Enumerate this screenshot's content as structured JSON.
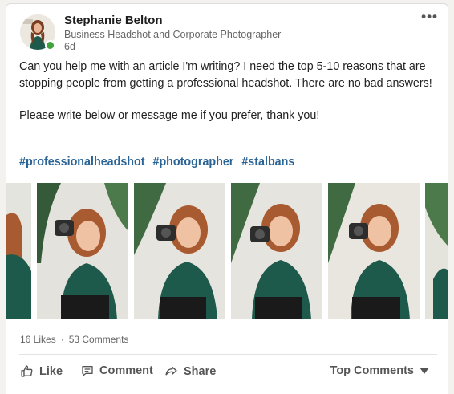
{
  "post": {
    "author_name": "Stephanie Belton",
    "author_headline": "Business Headshot and Corporate Photographer",
    "age": "6d",
    "more_label": "•••",
    "paragraphs": [
      "Can you help me with an article I'm writing? I need the top 5-10 reasons that are stopping people from getting a professional headshot. There are no bad answers!",
      "Please write below or message me if you prefer, thank you!"
    ],
    "hashtags": [
      "#professionalheadshot",
      "#photographer",
      "#stalbans"
    ],
    "presence": "online"
  },
  "social": {
    "likes": "16 Likes",
    "separator": "·",
    "comments": "53 Comments"
  },
  "actions": {
    "like": "Like",
    "comment": "Comment",
    "share": "Share",
    "sort": "Top Comments"
  },
  "colors": {
    "hashtag": "#2a6496",
    "presence": "#41a33d",
    "sweater": "#1e5a4c",
    "hair": "#a85a30"
  },
  "icons": [
    "like-icon",
    "comment-icon",
    "share-icon",
    "caret-down-icon",
    "more-icon"
  ]
}
